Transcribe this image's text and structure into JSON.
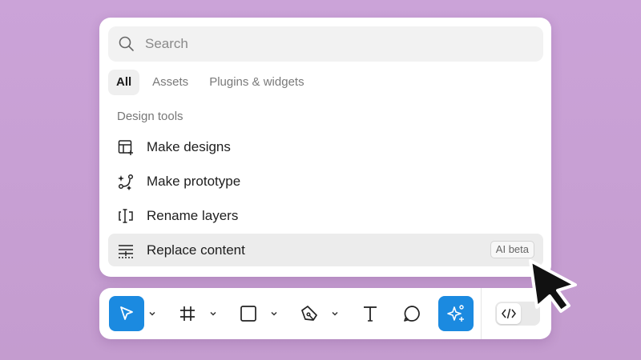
{
  "search": {
    "placeholder": "Search",
    "value": ""
  },
  "tabs": [
    {
      "label": "All",
      "active": true
    },
    {
      "label": "Assets",
      "active": false
    },
    {
      "label": "Plugins & widgets",
      "active": false
    }
  ],
  "section": {
    "label": "Design tools"
  },
  "items": [
    {
      "label": "Make designs",
      "icon": "layout-plus-icon"
    },
    {
      "label": "Make prototype",
      "icon": "sparkle-connect-icon"
    },
    {
      "label": "Rename layers",
      "icon": "rename-icon"
    },
    {
      "label": "Replace content",
      "icon": "replace-text-icon",
      "badge": "AI beta"
    }
  ],
  "toolbar": {
    "tools": [
      {
        "name": "move-tool",
        "icon": "cursor-arrow-icon",
        "active": true
      },
      {
        "name": "frame-tool",
        "icon": "hash-frame-icon",
        "active": false
      },
      {
        "name": "shape-tool",
        "icon": "rectangle-icon",
        "active": false
      },
      {
        "name": "pen-tool",
        "icon": "pen-nib-icon",
        "active": false
      },
      {
        "name": "text-tool",
        "icon": "text-t-icon",
        "active": false
      },
      {
        "name": "comment-tool",
        "icon": "speech-bubble-icon",
        "active": false
      },
      {
        "name": "actions-tool",
        "icon": "ai-sparkle-icon",
        "active": true
      }
    ],
    "dev_mode_icon": "code-brackets-icon"
  },
  "colors": {
    "background": "#c79fd2",
    "accent": "#1b8ae0",
    "panel": "#ffffff",
    "hover": "#ececec"
  }
}
